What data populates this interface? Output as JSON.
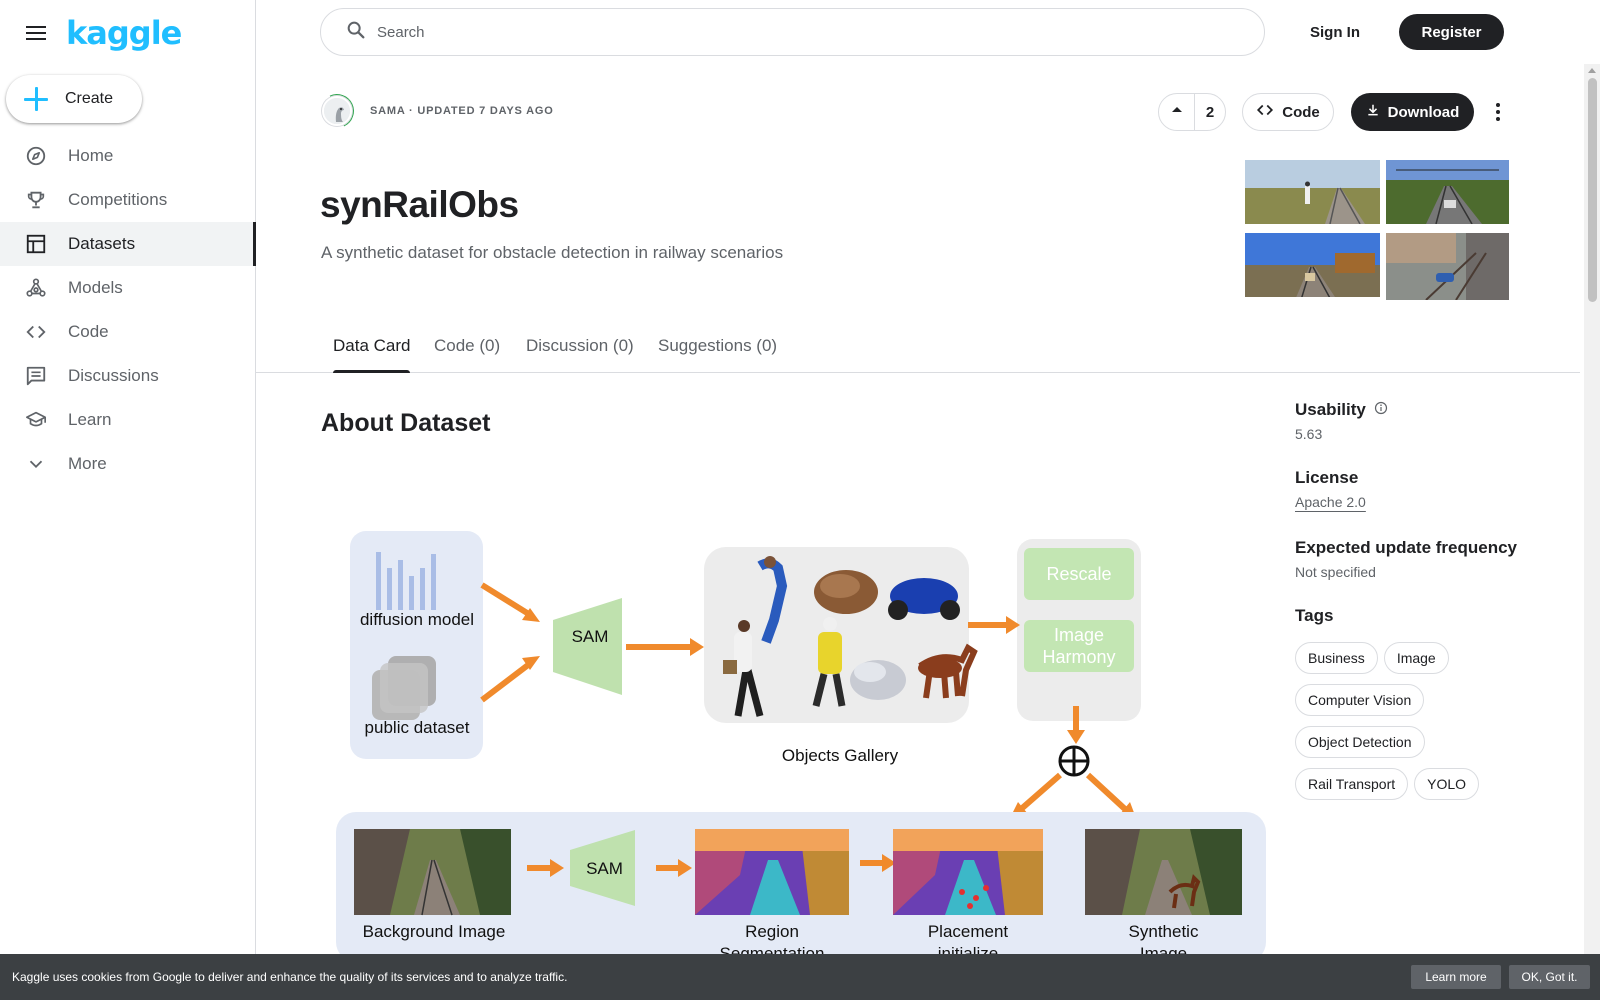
{
  "brand": {
    "logo_text": "kaggle",
    "accent": "#20beff"
  },
  "sidebar": {
    "create_label": "Create",
    "items": [
      {
        "label": "Home",
        "icon": "compass-icon"
      },
      {
        "label": "Competitions",
        "icon": "trophy-icon"
      },
      {
        "label": "Datasets",
        "icon": "table-icon",
        "active": true
      },
      {
        "label": "Models",
        "icon": "models-icon"
      },
      {
        "label": "Code",
        "icon": "code-icon"
      },
      {
        "label": "Discussions",
        "icon": "comments-icon"
      },
      {
        "label": "Learn",
        "icon": "school-icon"
      },
      {
        "label": "More",
        "icon": "chevron-down-icon"
      }
    ]
  },
  "header": {
    "search_placeholder": "Search",
    "sign_in": "Sign In",
    "register": "Register"
  },
  "dataset": {
    "owner_meta": "SAMA · UPDATED 7 DAYS AGO",
    "upvotes": "2",
    "code_label": "Code",
    "download_label": "Download",
    "title": "synRailObs",
    "subtitle": "A synthetic dataset for obstacle detection in railway scenarios"
  },
  "tabs": [
    {
      "label": "Data Card",
      "active": true
    },
    {
      "label": "Code (0)"
    },
    {
      "label": "Discussion (0)"
    },
    {
      "label": "Suggestions (0)"
    }
  ],
  "content": {
    "heading": "About Dataset",
    "diagram": {
      "diffusion_model": "diffusion model",
      "public_dataset": "public dataset",
      "sam": "SAM",
      "objects_gallery": "Objects Gallery",
      "rescale": "Rescale",
      "image_harmony_1": "Image",
      "image_harmony_2": "Harmony",
      "background_image": "Background Image",
      "region_1": "Region",
      "region_2": "Segmentation",
      "placement_1": "Placement",
      "placement_2": "initialize",
      "synthetic_1": "Synthetic",
      "synthetic_2": "Image"
    }
  },
  "side": {
    "usability_label": "Usability",
    "usability_value": "5.63",
    "license_label": "License",
    "license_value": "Apache 2.0",
    "frequency_label": "Expected update frequency",
    "frequency_value": "Not specified",
    "tags_label": "Tags",
    "tags": [
      "Business",
      "Image",
      "Computer Vision",
      "Object Detection",
      "Rail Transport",
      "YOLO"
    ]
  },
  "cookie": {
    "message": "Kaggle uses cookies from Google to deliver and enhance the quality of its services and to analyze traffic.",
    "learn_more": "Learn more",
    "ok": "OK, Got it."
  }
}
